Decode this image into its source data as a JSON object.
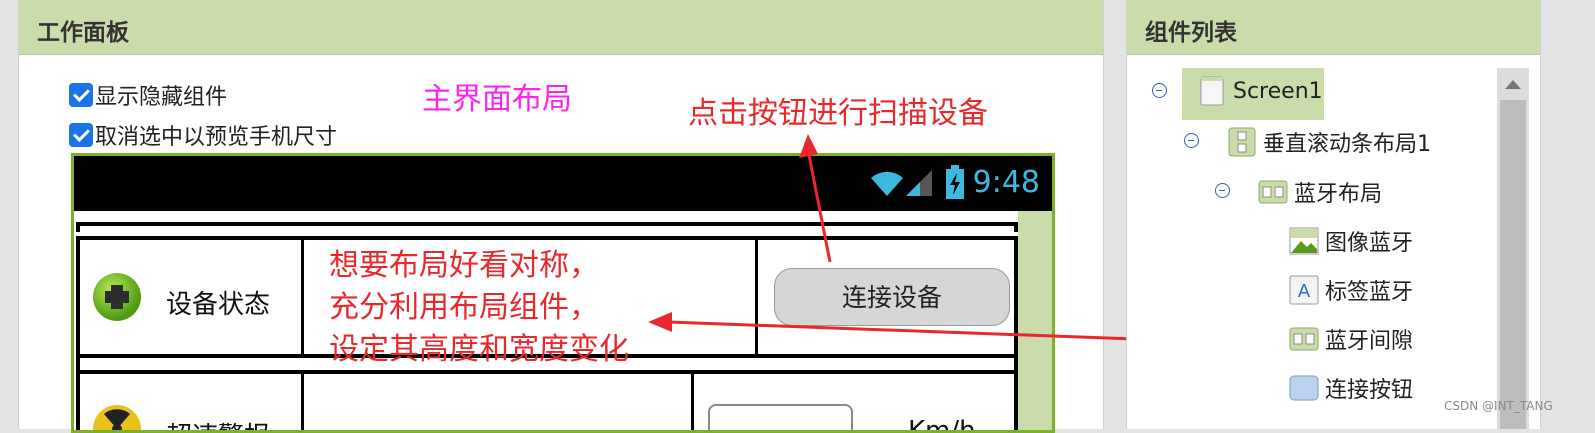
{
  "left_panel": {
    "title": "工作面板",
    "checkbox_show_hidden": "显示隐藏组件",
    "checkbox_preview_size": "取消选中以预览手机尺寸"
  },
  "annotations": {
    "main_layout": "主界面布局",
    "scan_hint": "点击按钮进行扫描设备",
    "layout_tip_1": "想要布局好看对称，",
    "layout_tip_2": "充分利用布局组件，",
    "layout_tip_3": "设定其高度和宽度变化",
    "main_layout_color": "#ff22ee",
    "annotation_color": "#e8282b"
  },
  "phone": {
    "clock": "9:48",
    "row1": {
      "label": "设备状态",
      "button": "连接设备"
    },
    "row2": {
      "label": "超速警报",
      "unit": "Km/h"
    }
  },
  "right_panel": {
    "title": "组件列表",
    "tree": [
      {
        "label": "Screen1",
        "icon": "screen-icon",
        "selected": true
      },
      {
        "label": "垂直滚动条布局1",
        "icon": "vertical-scroll-layout-icon"
      },
      {
        "label": "蓝牙布局",
        "icon": "horizontal-layout-icon"
      },
      {
        "label": "图像蓝牙",
        "icon": "image-icon"
      },
      {
        "label": "标签蓝牙",
        "icon": "label-icon"
      },
      {
        "label": "蓝牙间隙",
        "icon": "horizontal-layout-icon"
      },
      {
        "label": "连接按钮",
        "icon": "button-icon"
      }
    ]
  },
  "watermark": "CSDN @INT_TANG",
  "colors": {
    "header_bg": "#cbdcab",
    "phone_border": "#7db12a",
    "checkbox": "#1a73e8"
  }
}
